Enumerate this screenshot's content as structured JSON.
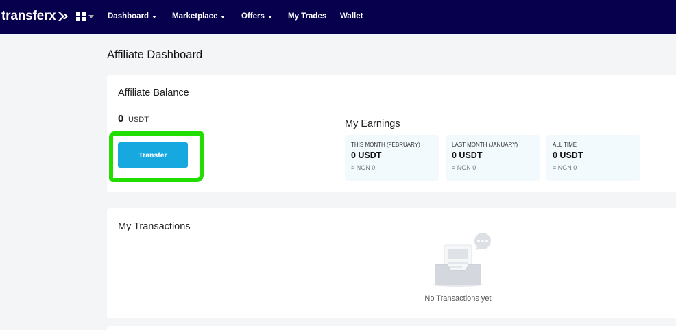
{
  "brand": {
    "logo_text": "transferx",
    "nav_bg": "#06004d",
    "accent": "#17a8e0",
    "highlight": "#22dd00"
  },
  "nav": {
    "apps_icon": "grid-icon",
    "items": [
      {
        "label": "Dashboard",
        "dropdown": true
      },
      {
        "label": "Marketplace",
        "dropdown": true
      },
      {
        "label": "Offers",
        "dropdown": true
      },
      {
        "label": "My Trades",
        "dropdown": false
      },
      {
        "label": "Wallet",
        "dropdown": false
      }
    ]
  },
  "page": {
    "title": "Affiliate Dashboard"
  },
  "balance": {
    "title": "Affiliate Balance",
    "value": "0",
    "unit": "USDT",
    "ngn": "= 0 NGN",
    "transfer_label": "Transfer"
  },
  "earnings": {
    "title": "My Earnings",
    "boxes": [
      {
        "label": "THIS MONTH (FEBRUARY)",
        "value": "0 USDT",
        "ngn": "= NGN 0"
      },
      {
        "label": "LAST MONTH (JANUARY)",
        "value": "0 USDT",
        "ngn": "= NGN 0"
      },
      {
        "label": "ALL TIME",
        "value": "0 USDT",
        "ngn": "= NGN 0"
      }
    ]
  },
  "transactions": {
    "title": "My Transactions",
    "empty_icon": "empty-inbox-icon",
    "empty_text": "No Transactions yet"
  }
}
